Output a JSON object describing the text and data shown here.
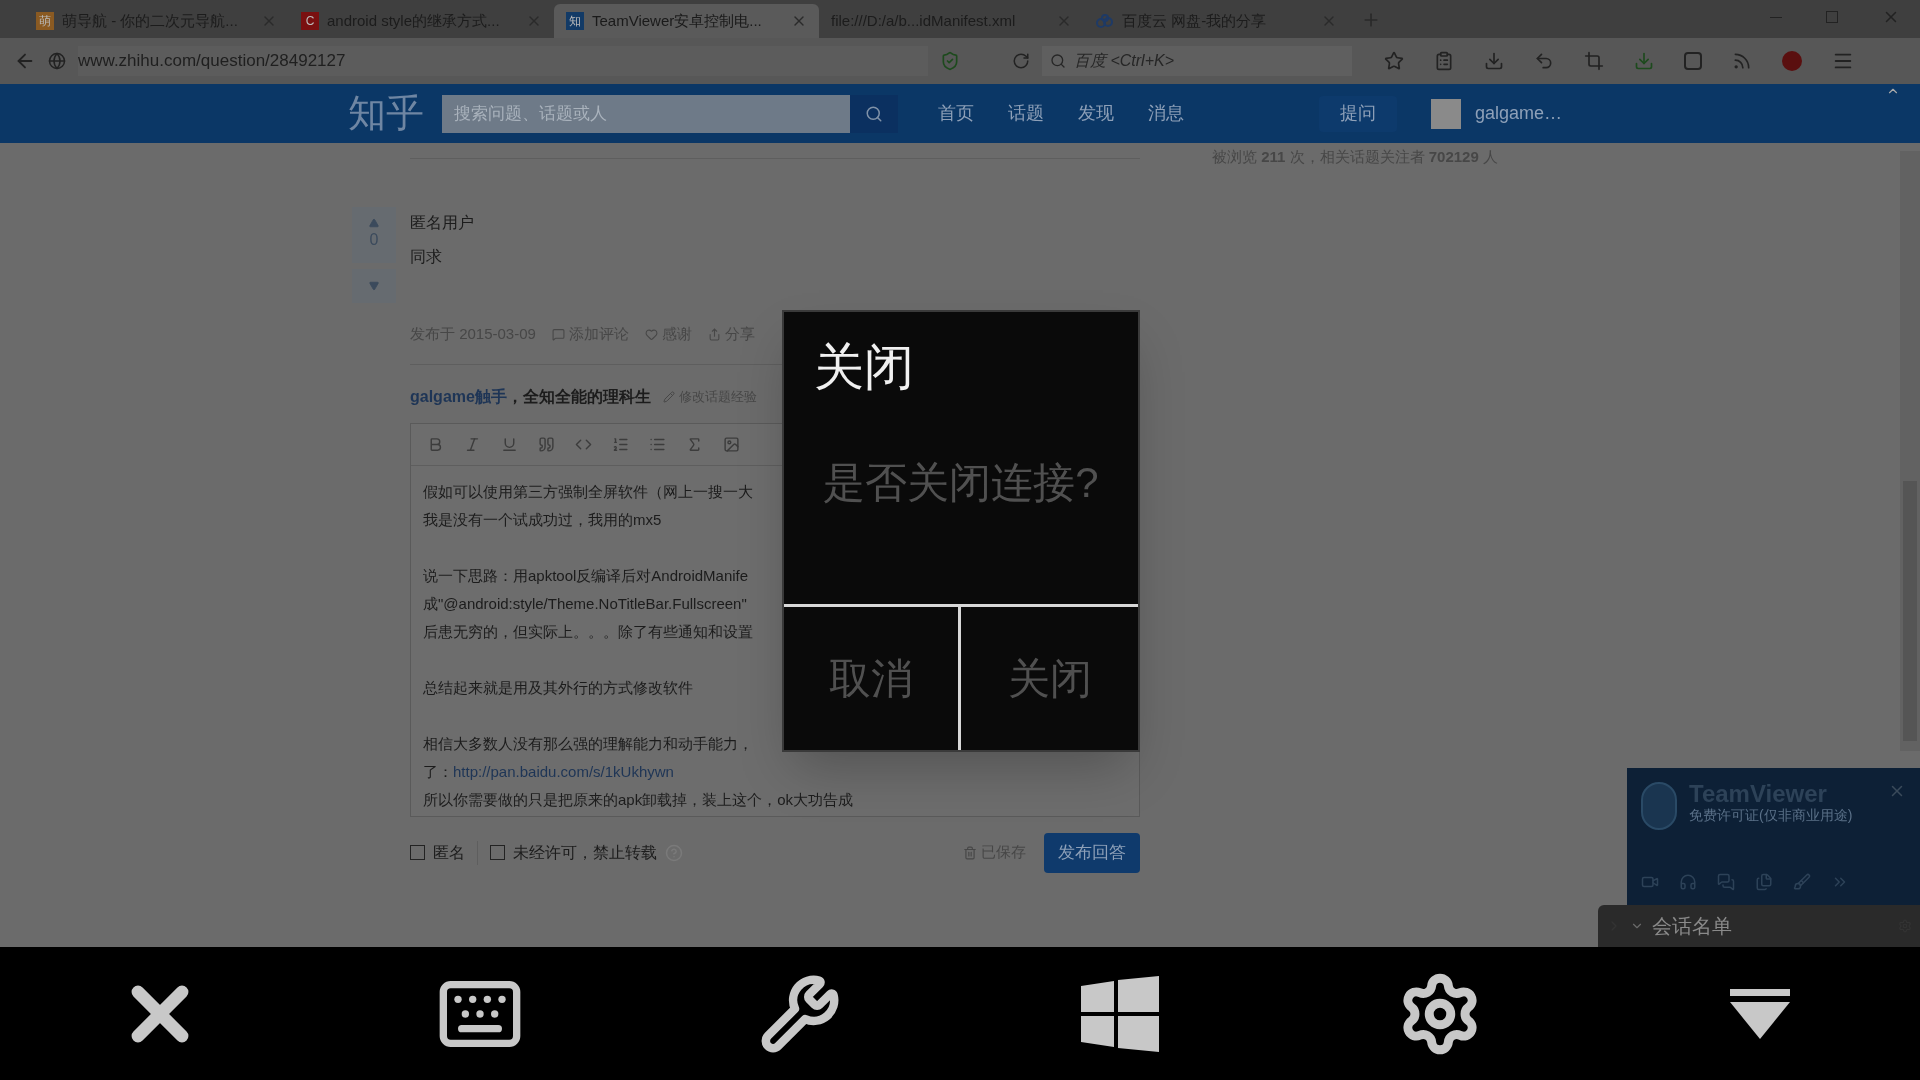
{
  "browser": {
    "tabs": [
      {
        "title": "萌导航 - 你的二次元导航...",
        "selected": false,
        "icon": "萌"
      },
      {
        "title": "android style的继承方式...",
        "selected": false,
        "icon": "C"
      },
      {
        "title": "TeamViewer安卓控制电...",
        "selected": true,
        "icon": "知"
      },
      {
        "title": "file:///D:/a/b...idManifest.xml",
        "selected": false
      },
      {
        "title": "百度云 网盘-我的分享",
        "selected": false
      }
    ],
    "address": "www.zhihu.com/question/28492127",
    "search_placeholder": "百度 <Ctrl+K>"
  },
  "header": {
    "logo": "知乎",
    "search_placeholder": "搜索问题、话题或人",
    "nav": [
      "首页",
      "话题",
      "发现",
      "消息"
    ],
    "ask_button": "提问",
    "user": "galgame…"
  },
  "stats": "被浏览 **211** 次，相关话题关注者 **702129** 人",
  "answer": {
    "votes": "0",
    "author": "匿名用户",
    "body": "同求",
    "date": "发布于 2015-03-09",
    "actions": [
      "添加评论",
      "感谢",
      "分享"
    ]
  },
  "composer": {
    "author": "galgame触手",
    "bio": "，全知全能的理科生",
    "edit": "修改话题经验",
    "paragraphs": [
      {
        "lines": [
          {
            "text": "假如可以使用第三方强制全屏软件（网上一搜一大"
          },
          {
            "text": "我是没有一个试成功过，我用的mx5"
          }
        ]
      },
      {
        "lines": [
          {
            "text": "说一下思路：用apktool反编译后对AndroidManife"
          },
          {
            "text": "成\"@android:style/Theme.NoTitleBar.Fullscreen\""
          },
          {
            "text": "后患无穷的，但实际上。。。除了有些通知和设置"
          }
        ]
      },
      {
        "lines": [
          {
            "text": "总结起来就是用及其外行的方式修改软件"
          }
        ]
      },
      {
        "lines": [
          {
            "text": "相信大多数人没有那么强的理解能力和动手能力，"
          },
          {
            "text": "了：",
            "link": "http://pan.baidu.com/s/1kUkhywn"
          },
          {
            "text": "所以你需要做的只是把原来的apk卸载掉，装上这个，ok大功告成"
          }
        ]
      }
    ],
    "options": [
      {
        "label": "匿名",
        "checked": false
      },
      {
        "label": "未经许可，禁止转载",
        "checked": false
      }
    ],
    "saved": "已保存",
    "submit": "发布回答"
  },
  "dialog": {
    "title": "关闭",
    "message": "是否关闭连接?",
    "buttons": [
      "取消",
      "关闭"
    ]
  },
  "teamviewer": {
    "name": "TeamViewer",
    "license": "免费许可证(仅非商业用途)",
    "session_list": "会话名单"
  }
}
